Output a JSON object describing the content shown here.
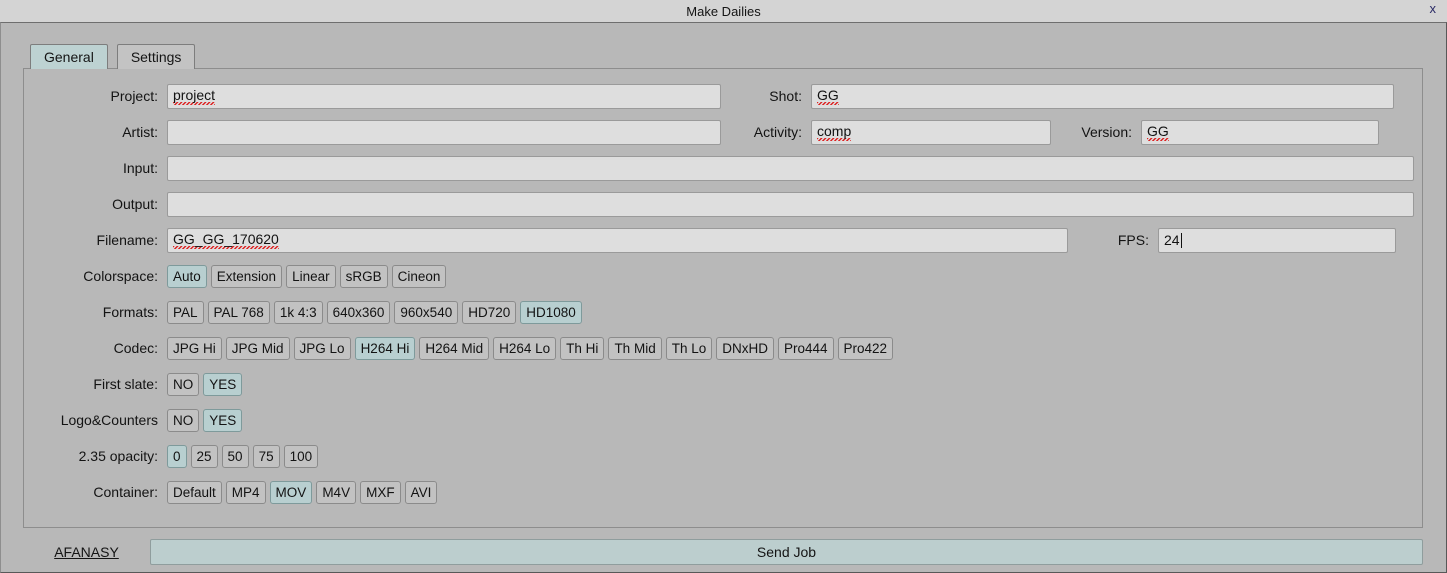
{
  "titlebar": {
    "title": "Make Dailies",
    "close_label": "x"
  },
  "tabs": [
    {
      "label": "General",
      "active": true
    },
    {
      "label": "Settings",
      "active": false
    }
  ],
  "form": {
    "project": {
      "label": "Project:",
      "value": "project",
      "placeholder": ""
    },
    "shot": {
      "label": "Shot:",
      "value": "GG",
      "placeholder": ""
    },
    "artist": {
      "label": "Artist:",
      "value": "",
      "placeholder": ""
    },
    "activity": {
      "label": "Activity:",
      "value": "comp",
      "placeholder": ""
    },
    "version": {
      "label": "Version:",
      "value": "GG",
      "placeholder": ""
    },
    "input": {
      "label": "Input:",
      "value": "",
      "placeholder": ""
    },
    "output": {
      "label": "Output:",
      "value": "",
      "placeholder": ""
    },
    "filename": {
      "label": "Filename:",
      "value": "GG_GG_170620",
      "placeholder": ""
    },
    "fps": {
      "label": "FPS:",
      "value": "24",
      "placeholder": ""
    }
  },
  "option_rows": [
    {
      "key": "colorspace",
      "label": "Colorspace:",
      "options": [
        "Auto",
        "Extension",
        "Linear",
        "sRGB",
        "Cineon"
      ],
      "selected": "Auto"
    },
    {
      "key": "formats",
      "label": "Formats:",
      "options": [
        "PAL",
        "PAL 768",
        "1k 4:3",
        "640x360",
        "960x540",
        "HD720",
        "HD1080"
      ],
      "selected": "HD1080"
    },
    {
      "key": "codec",
      "label": "Codec:",
      "options": [
        "JPG Hi",
        "JPG Mid",
        "JPG Lo",
        "H264 Hi",
        "H264 Mid",
        "H264 Lo",
        "Th Hi",
        "Th Mid",
        "Th Lo",
        "DNxHD",
        "Pro444",
        "Pro422"
      ],
      "selected": "H264 Hi"
    },
    {
      "key": "first_slate",
      "label": "First slate:",
      "options": [
        "NO",
        "YES"
      ],
      "selected": "YES"
    },
    {
      "key": "logo_counters",
      "label": "Logo&Counters",
      "options": [
        "NO",
        "YES"
      ],
      "selected": "YES"
    },
    {
      "key": "opacity_235",
      "label": "2.35 opacity:",
      "options": [
        "0",
        "25",
        "50",
        "75",
        "100"
      ],
      "selected": "0"
    },
    {
      "key": "container",
      "label": "Container:",
      "options": [
        "Default",
        "MP4",
        "MOV",
        "M4V",
        "MXF",
        "AVI"
      ],
      "selected": "MOV"
    }
  ],
  "footer": {
    "afanasy_label": "AFANASY",
    "send_job_label": "Send Job"
  },
  "colors": {
    "window_bg": "#b8b8b8",
    "titlebar_bg": "#d4d4d4",
    "field_bg": "#dedede",
    "option_bg": "#c2c2c2",
    "option_selected": "#b8cfd0",
    "tab_active": "#bdd2d2",
    "send_job_bg": "#bccece",
    "misspell_underline": "#dd2222"
  }
}
